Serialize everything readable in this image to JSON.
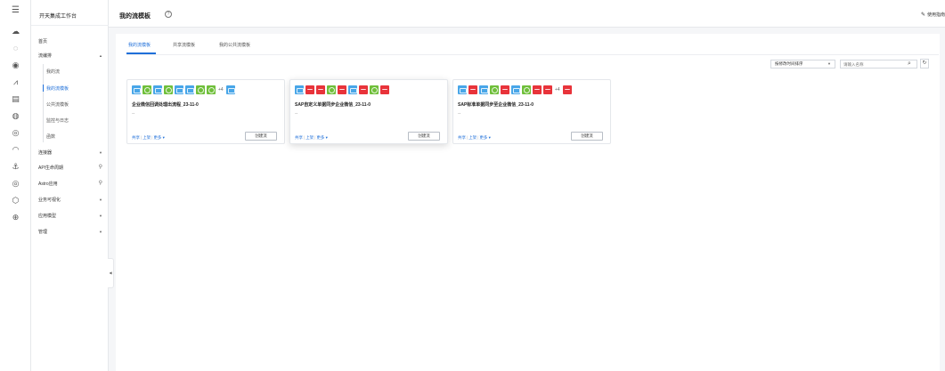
{
  "rail": {
    "icons": [
      "menu-icon",
      "cloud-icon",
      "cloud-outline-icon",
      "database-icon",
      "mountain-icon",
      "document-icon",
      "cloud-sync-icon",
      "hdd-icon",
      "cloud-storage-icon",
      "anchor-icon",
      "target-icon",
      "cube-icon",
      "globe-icon"
    ]
  },
  "nav": {
    "title": "开天集成工作台",
    "home": "首页",
    "flow_center": "流编排",
    "my_flows": "我的流",
    "my_templates": "我的流模板",
    "public_templates": "公共流模板",
    "monitor_logs": "监控与日志",
    "functions": "函数",
    "connectors": "连接器",
    "api_lifecycle": "API生命周期",
    "astro_apps": "Astro应用",
    "business_visual": "业务可视化",
    "app_template": "应用模型",
    "manage": "管理"
  },
  "header": {
    "title": "我的流模板",
    "guide": "使用指南"
  },
  "tabs": [
    "我的流模板",
    "共享流模板",
    "我的公共流模板"
  ],
  "toolbar": {
    "sort_value": "按修改时间排序",
    "search_placeholder": "请输入名称"
  },
  "cards": [
    {
      "title": "企业微信回调处理出流程_23-11-0",
      "desc": "--",
      "more_count": "+4",
      "icon_colors": [
        "b",
        "g",
        "b",
        "g",
        "b",
        "b",
        "g",
        "g"
      ],
      "tail_icon": "b",
      "actions": [
        "共享",
        "上架",
        "更多"
      ],
      "create_label": "创建流"
    },
    {
      "title": "SAP自定义单据同步企业微信_23-11-0",
      "desc": "--",
      "more_count": "",
      "icon_colors": [
        "b",
        "r",
        "r",
        "g",
        "r",
        "b",
        "r",
        "g",
        "r"
      ],
      "tail_icon": "",
      "actions": [
        "共享",
        "上架",
        "更多"
      ],
      "create_label": "创建流"
    },
    {
      "title": "SAP标准单据同步至企业微信_23-11-0",
      "desc": "--",
      "more_count": "+4",
      "icon_colors": [
        "b",
        "r",
        "b",
        "g",
        "r",
        "b",
        "g",
        "r",
        "r"
      ],
      "tail_icon": "r",
      "actions": [
        "共享",
        "上架",
        "更多"
      ],
      "create_label": "创建流"
    }
  ]
}
